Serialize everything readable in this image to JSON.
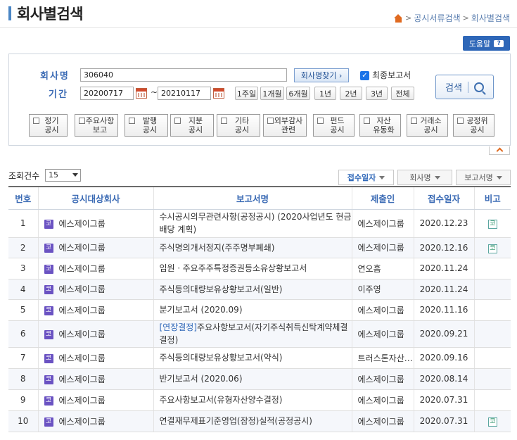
{
  "header": {
    "title": "회사별검색",
    "breadcrumb": [
      "공시서류검색",
      "회사별검색"
    ]
  },
  "help": {
    "label": "도움말",
    "icon_text": "?"
  },
  "search": {
    "company_label": "회사명",
    "company_value": "306040",
    "find_company_label": "회사명찾기 ›",
    "final_report_label": "최종보고서",
    "final_report_checked": true,
    "period_label": "기간",
    "date_from": "20200717",
    "date_to": "20210117",
    "date_sep": "~",
    "period_buttons": [
      "1주일",
      "1개월",
      "6개월",
      "1년",
      "2년",
      "3년",
      "전체"
    ],
    "search_button_label": "검색"
  },
  "categories": [
    {
      "line1": "정기",
      "line2": "공시"
    },
    {
      "line1": "주요사항",
      "line2": "보고"
    },
    {
      "line1": "발행",
      "line2": "공시"
    },
    {
      "line1": "지분",
      "line2": "공시"
    },
    {
      "line1": "기타",
      "line2": "공시"
    },
    {
      "line1": "외부감사",
      "line2": "관련"
    },
    {
      "line1": "펀드",
      "line2": "공시"
    },
    {
      "line1": "자산",
      "line2": "유동화"
    },
    {
      "line1": "거래소",
      "line2": "공시"
    },
    {
      "line1": "공정위",
      "line2": "공시"
    }
  ],
  "list_controls": {
    "count_label": "조회건수",
    "count_value": "15",
    "sort_buttons": [
      "접수일자",
      "회사명",
      "보고서명"
    ]
  },
  "table": {
    "headers": [
      "번호",
      "공시대상회사",
      "보고서명",
      "제출인",
      "접수일자",
      "비고"
    ],
    "rows": [
      {
        "no": "1",
        "company": "에스제이그룹",
        "tag": "",
        "report": "수시공시의무관련사항(공정공시) (2020사업년도 현금배당 계획)",
        "submitter": "에스제이그룹",
        "date": "2020.12.23",
        "note": "코"
      },
      {
        "no": "2",
        "company": "에스제이그룹",
        "tag": "",
        "report": "주식명의개서정지(주주명부폐쇄)",
        "submitter": "에스제이그룹",
        "date": "2020.12.16",
        "note": "코"
      },
      {
        "no": "3",
        "company": "에스제이그룹",
        "tag": "",
        "report": "임원ㆍ주요주주특정증권등소유상황보고서",
        "submitter": "연오흠",
        "date": "2020.11.24",
        "note": ""
      },
      {
        "no": "4",
        "company": "에스제이그룹",
        "tag": "",
        "report": "주식등의대량보유상황보고서(일반)",
        "submitter": "이주영",
        "date": "2020.11.24",
        "note": ""
      },
      {
        "no": "5",
        "company": "에스제이그룹",
        "tag": "",
        "report": "분기보고서 (2020.09)",
        "submitter": "에스제이그룹",
        "date": "2020.11.16",
        "note": ""
      },
      {
        "no": "6",
        "company": "에스제이그룹",
        "tag": "[연장결정]",
        "report": "주요사항보고서(자기주식취득신탁계약체결결정)",
        "submitter": "에스제이그룹",
        "date": "2020.09.21",
        "note": ""
      },
      {
        "no": "7",
        "company": "에스제이그룹",
        "tag": "",
        "report": "주식등의대량보유상황보고서(약식)",
        "submitter": "트러스톤자산…",
        "date": "2020.09.16",
        "note": ""
      },
      {
        "no": "8",
        "company": "에스제이그룹",
        "tag": "",
        "report": "반기보고서 (2020.06)",
        "submitter": "에스제이그룹",
        "date": "2020.08.14",
        "note": ""
      },
      {
        "no": "9",
        "company": "에스제이그룹",
        "tag": "",
        "report": "주요사항보고서(유형자산양수결정)",
        "submitter": "에스제이그룹",
        "date": "2020.07.31",
        "note": ""
      },
      {
        "no": "10",
        "company": "에스제이그룹",
        "tag": "",
        "report": "연결재무제표기준영업(잠정)실적(공정공시)",
        "submitter": "에스제이그룹",
        "date": "2020.07.31",
        "note": "코"
      }
    ],
    "company_icon": "코"
  },
  "colors": {
    "accent": "#2e67b8",
    "label": "#3a6ab4",
    "home_icon": "#e06a20",
    "company_icon": "#6a52c2"
  }
}
